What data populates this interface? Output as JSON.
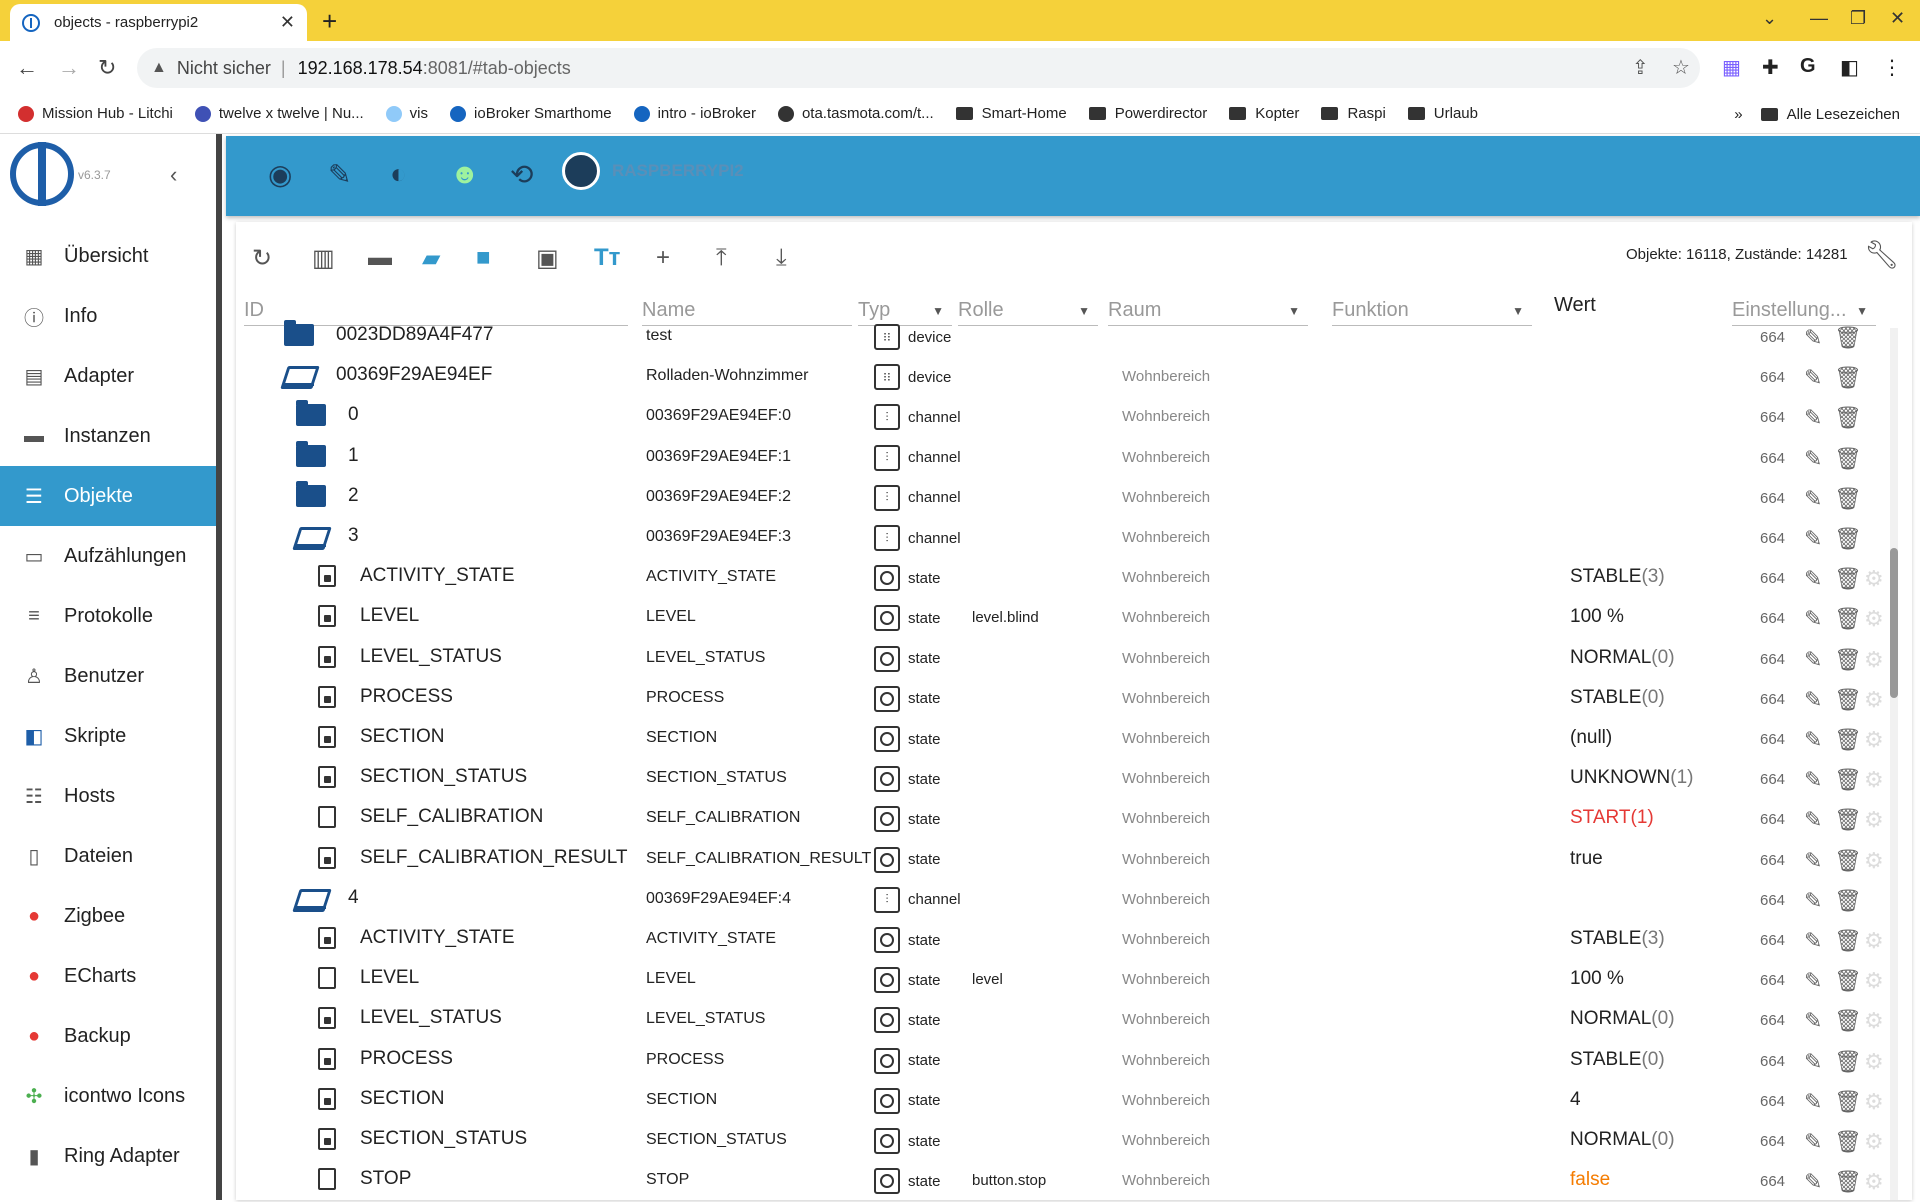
{
  "browser": {
    "tab_title": "objects - raspberrypi2",
    "address_insecure": "Nicht sicher",
    "address_host": "192.168.178.54",
    "address_path": ":8081/#tab-objects",
    "bookmarks": [
      {
        "label": "Mission Hub - Litchi",
        "kind": "site",
        "color": "#d32f2f"
      },
      {
        "label": "twelve x twelve | Nu...",
        "kind": "site",
        "color": "#3f51b5"
      },
      {
        "label": "vis",
        "kind": "site",
        "color": "#90caf9"
      },
      {
        "label": "ioBroker Smarthome",
        "kind": "site",
        "color": "#1565c0"
      },
      {
        "label": "intro - ioBroker",
        "kind": "site",
        "color": "#1565c0"
      },
      {
        "label": "ota.tasmota.com/t...",
        "kind": "site",
        "color": "#333333"
      },
      {
        "label": "Smart-Home",
        "kind": "folder"
      },
      {
        "label": "Powerdirector",
        "kind": "folder"
      },
      {
        "label": "Kopter",
        "kind": "folder"
      },
      {
        "label": "Raspi",
        "kind": "folder"
      },
      {
        "label": "Urlaub",
        "kind": "folder"
      }
    ],
    "bookmarks_more": "»",
    "all_bookmarks": "Alle Lesezeichen"
  },
  "sidebar": {
    "version": "v6.3.7",
    "items": [
      {
        "label": "Übersicht",
        "icon": "grid-icon",
        "glyph": "▦"
      },
      {
        "label": "Info",
        "icon": "info-icon",
        "glyph": "ⓘ"
      },
      {
        "label": "Adapter",
        "icon": "store-icon",
        "glyph": "▤"
      },
      {
        "label": "Instanzen",
        "icon": "instances-icon",
        "glyph": "▬"
      },
      {
        "label": "Objekte",
        "icon": "list-icon",
        "glyph": "☰",
        "active": true
      },
      {
        "label": "Aufzählungen",
        "icon": "enum-icon",
        "glyph": "▭"
      },
      {
        "label": "Protokolle",
        "icon": "log-icon",
        "glyph": "≡"
      },
      {
        "label": "Benutzer",
        "icon": "user-icon",
        "glyph": "♙"
      },
      {
        "label": "Skripte",
        "icon": "js-icon",
        "glyph": "◧"
      },
      {
        "label": "Hosts",
        "icon": "hosts-icon",
        "glyph": "☷"
      },
      {
        "label": "Dateien",
        "icon": "files-icon",
        "glyph": "▯"
      },
      {
        "label": "Zigbee",
        "icon": "zigbee-icon",
        "glyph": "●"
      },
      {
        "label": "ECharts",
        "icon": "echarts-icon",
        "glyph": "●"
      },
      {
        "label": "Backup",
        "icon": "backup-icon",
        "glyph": "●"
      },
      {
        "label": "icontwo Icons",
        "icon": "icontwo-icon",
        "glyph": "✣"
      },
      {
        "label": "Ring Adapter",
        "icon": "ring-icon",
        "glyph": "▮"
      }
    ]
  },
  "host": {
    "name": "RASPBERRYPI2"
  },
  "toolbar": {
    "counts": "Objekte: 16118, Zustände: 14281"
  },
  "columns": {
    "id": "ID",
    "name": "Name",
    "typ": "Typ",
    "rolle": "Rolle",
    "raum": "Raum",
    "funktion": "Funktion",
    "wert": "Wert",
    "einstellung": "Einstellung..."
  },
  "rows": [
    {
      "id": "0023DD89A4F477",
      "name": "test",
      "typ": "device",
      "rolle": "",
      "raum": "",
      "wert": "",
      "wert_sub": "",
      "acl": "664",
      "level": 1,
      "icon": "folder-closed",
      "gear": false
    },
    {
      "id": "00369F29AE94EF",
      "name": "Rolladen-Wohnzimmer",
      "typ": "device",
      "rolle": "",
      "raum": "Wohnbereich",
      "wert": "",
      "wert_sub": "",
      "acl": "664",
      "level": 1,
      "icon": "folder-open",
      "gear": false
    },
    {
      "id": "0",
      "name": "00369F29AE94EF:0",
      "typ": "channel",
      "rolle": "",
      "raum": "Wohnbereich",
      "wert": "",
      "wert_sub": "",
      "acl": "664",
      "level": 2,
      "icon": "folder-closed",
      "gear": false
    },
    {
      "id": "1",
      "name": "00369F29AE94EF:1",
      "typ": "channel",
      "rolle": "",
      "raum": "Wohnbereich",
      "wert": "",
      "wert_sub": "",
      "acl": "664",
      "level": 2,
      "icon": "folder-closed",
      "gear": false
    },
    {
      "id": "2",
      "name": "00369F29AE94EF:2",
      "typ": "channel",
      "rolle": "",
      "raum": "Wohnbereich",
      "wert": "",
      "wert_sub": "",
      "acl": "664",
      "level": 2,
      "icon": "folder-closed",
      "gear": false
    },
    {
      "id": "3",
      "name": "00369F29AE94EF:3",
      "typ": "channel",
      "rolle": "",
      "raum": "Wohnbereich",
      "wert": "",
      "wert_sub": "",
      "acl": "664",
      "level": 2,
      "icon": "folder-open",
      "gear": false
    },
    {
      "id": "ACTIVITY_STATE",
      "name": "ACTIVITY_STATE",
      "typ": "state",
      "rolle": "",
      "raum": "Wohnbereich",
      "wert": "STABLE",
      "wert_sub": "(3)",
      "acl": "664",
      "level": 3,
      "icon": "file-lock",
      "gear": true
    },
    {
      "id": "LEVEL",
      "name": "LEVEL",
      "typ": "state",
      "rolle": "level.blind",
      "raum": "Wohnbereich",
      "wert": "100 %",
      "wert_sub": "",
      "acl": "664",
      "level": 3,
      "icon": "file-lock",
      "gear": true
    },
    {
      "id": "LEVEL_STATUS",
      "name": "LEVEL_STATUS",
      "typ": "state",
      "rolle": "",
      "raum": "Wohnbereich",
      "wert": "NORMAL",
      "wert_sub": "(0)",
      "acl": "664",
      "level": 3,
      "icon": "file-lock",
      "gear": true
    },
    {
      "id": "PROCESS",
      "name": "PROCESS",
      "typ": "state",
      "rolle": "",
      "raum": "Wohnbereich",
      "wert": "STABLE",
      "wert_sub": "(0)",
      "acl": "664",
      "level": 3,
      "icon": "file-lock",
      "gear": true
    },
    {
      "id": "SECTION",
      "name": "SECTION",
      "typ": "state",
      "rolle": "",
      "raum": "Wohnbereich",
      "wert": "(null)",
      "wert_sub": "",
      "acl": "664",
      "level": 3,
      "icon": "file-lock",
      "gear": true
    },
    {
      "id": "SECTION_STATUS",
      "name": "SECTION_STATUS",
      "typ": "state",
      "rolle": "",
      "raum": "Wohnbereich",
      "wert": "UNKNOWN",
      "wert_sub": "(1)",
      "acl": "664",
      "level": 3,
      "icon": "file-lock",
      "gear": true
    },
    {
      "id": "SELF_CALIBRATION",
      "name": "SELF_CALIBRATION",
      "typ": "state",
      "rolle": "",
      "raum": "Wohnbereich",
      "wert": "START(1)",
      "wert_sub": "",
      "acl": "664",
      "level": 3,
      "icon": "file",
      "gear": true,
      "color": "red"
    },
    {
      "id": "SELF_CALIBRATION_RESULT",
      "name": "SELF_CALIBRATION_RESULT",
      "typ": "state",
      "rolle": "",
      "raum": "Wohnbereich",
      "wert": "true",
      "wert_sub": "",
      "acl": "664",
      "level": 3,
      "icon": "file-lock",
      "gear": true
    },
    {
      "id": "4",
      "name": "00369F29AE94EF:4",
      "typ": "channel",
      "rolle": "",
      "raum": "Wohnbereich",
      "wert": "",
      "wert_sub": "",
      "acl": "664",
      "level": 2,
      "icon": "folder-open",
      "gear": false
    },
    {
      "id": "ACTIVITY_STATE",
      "name": "ACTIVITY_STATE",
      "typ": "state",
      "rolle": "",
      "raum": "Wohnbereich",
      "wert": "STABLE",
      "wert_sub": "(3)",
      "acl": "664",
      "level": 3,
      "icon": "file-lock",
      "gear": true
    },
    {
      "id": "LEVEL",
      "name": "LEVEL",
      "typ": "state",
      "rolle": "level",
      "raum": "Wohnbereich",
      "wert": "100 %",
      "wert_sub": "",
      "acl": "664",
      "level": 3,
      "icon": "file",
      "gear": true
    },
    {
      "id": "LEVEL_STATUS",
      "name": "LEVEL_STATUS",
      "typ": "state",
      "rolle": "",
      "raum": "Wohnbereich",
      "wert": "NORMAL",
      "wert_sub": "(0)",
      "acl": "664",
      "level": 3,
      "icon": "file-lock",
      "gear": true
    },
    {
      "id": "PROCESS",
      "name": "PROCESS",
      "typ": "state",
      "rolle": "",
      "raum": "Wohnbereich",
      "wert": "STABLE",
      "wert_sub": "(0)",
      "acl": "664",
      "level": 3,
      "icon": "file-lock",
      "gear": true
    },
    {
      "id": "SECTION",
      "name": "SECTION",
      "typ": "state",
      "rolle": "",
      "raum": "Wohnbereich",
      "wert": "4",
      "wert_sub": "",
      "acl": "664",
      "level": 3,
      "icon": "file-lock",
      "gear": true
    },
    {
      "id": "SECTION_STATUS",
      "name": "SECTION_STATUS",
      "typ": "state",
      "rolle": "",
      "raum": "Wohnbereich",
      "wert": "NORMAL",
      "wert_sub": "(0)",
      "acl": "664",
      "level": 3,
      "icon": "file-lock",
      "gear": true
    },
    {
      "id": "STOP",
      "name": "STOP",
      "typ": "state",
      "rolle": "button.stop",
      "raum": "Wohnbereich",
      "wert": "false",
      "wert_sub": "",
      "acl": "664",
      "level": 3,
      "icon": "file",
      "gear": true,
      "color": "orange"
    }
  ]
}
